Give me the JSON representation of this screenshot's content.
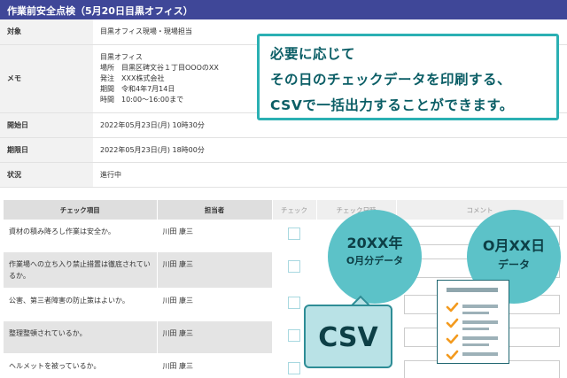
{
  "header": {
    "title": "作業前安全点検（5月20日目黒オフィス）"
  },
  "info": {
    "target_label": "対象",
    "target_value": "目黒オフィス現場・現場担当",
    "memo_label": "メモ",
    "memo_lines": [
      {
        "key": "",
        "value": "目黒オフィス"
      },
      {
        "key": "場所",
        "value": "目黒区碑文谷１丁目OOOのXX"
      },
      {
        "key": "発注",
        "value": "XXX株式会社"
      },
      {
        "key": "期間",
        "value": "令和4年7月14日"
      },
      {
        "key": "時間",
        "value": "10:00～16:00まで"
      }
    ],
    "start_label": "開始日",
    "start_value": "2022年05月23日(月) 10時30分",
    "due_label": "期限日",
    "due_value": "2022年05月23日(月) 18時00分",
    "status_label": "状況",
    "status_value": "進行中"
  },
  "checklist": {
    "headers": {
      "item": "チェック項目",
      "person": "担当者",
      "check": "チェック",
      "datetime": "チェック日時",
      "comment": "コメント"
    },
    "rows": [
      {
        "item": "資材の積み降ろし作業は安全か。",
        "person": "川田 康三"
      },
      {
        "item": "作業場への立ち入り禁止措置は徹底されているか。",
        "person": "川田 康三"
      },
      {
        "item": "公害、第三者障害の防止策はよいか。",
        "person": "川田 康三"
      },
      {
        "item": "整理整頓されているか。",
        "person": "川田 康三"
      },
      {
        "item": "ヘルメットを被っているか。",
        "person": "川田 康三"
      }
    ]
  },
  "callout": {
    "line1": "必要に応じて",
    "line2": "その日のチェックデータを印刷する、",
    "line3": "CSVで一括出力することができます。"
  },
  "badges": {
    "monthly_line1": "20XX年",
    "monthly_line2": "O月分データ",
    "daily_line1": "O月XX日",
    "daily_line2": "データ",
    "csv": "CSV"
  },
  "colors": {
    "title_bar": "#3f4798",
    "accent": "#2bb0b3",
    "circle": "#5cc2c8",
    "check_orange": "#f39a1e"
  }
}
